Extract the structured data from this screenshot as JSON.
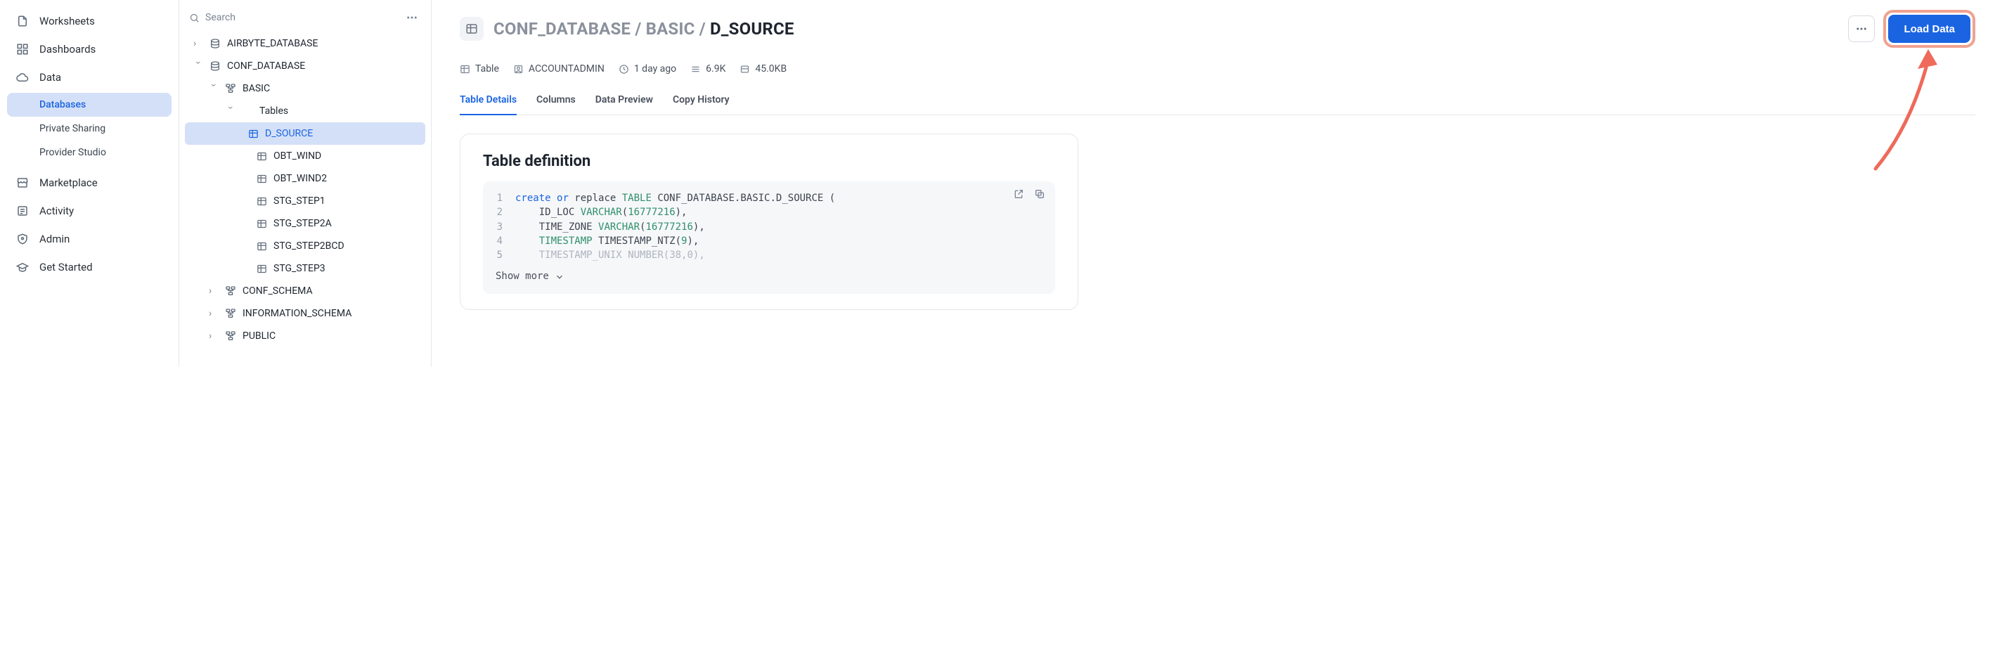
{
  "nav": {
    "items": [
      {
        "label": "Worksheets"
      },
      {
        "label": "Dashboards"
      },
      {
        "label": "Data"
      },
      {
        "label": "Marketplace"
      },
      {
        "label": "Activity"
      },
      {
        "label": "Admin"
      },
      {
        "label": "Get Started"
      }
    ],
    "data_sub": [
      {
        "label": "Databases"
      },
      {
        "label": "Private Sharing"
      },
      {
        "label": "Provider Studio"
      }
    ]
  },
  "search": {
    "placeholder": "Search"
  },
  "tree": {
    "db_airbyte": "AIRBYTE_DATABASE",
    "db_conf": "CONF_DATABASE",
    "schema_basic": "BASIC",
    "group_tables": "Tables",
    "tables": [
      "D_SOURCE",
      "OBT_WIND",
      "OBT_WIND2",
      "STG_STEP1",
      "STG_STEP2A",
      "STG_STEP2BCD",
      "STG_STEP3"
    ],
    "schema_conf": "CONF_SCHEMA",
    "schema_info": "INFORMATION_SCHEMA",
    "schema_public": "PUBLIC"
  },
  "header": {
    "crumb_db": "CONF_DATABASE",
    "crumb_schema": "BASIC",
    "crumb_table": "D_SOURCE",
    "load_label": "Load Data"
  },
  "meta": {
    "type": "Table",
    "role": "ACCOUNTADMIN",
    "age": "1 day ago",
    "rows": "6.9K",
    "size": "45.0KB"
  },
  "tabs": [
    "Table Details",
    "Columns",
    "Data Preview",
    "Copy History"
  ],
  "card": {
    "title": "Table definition",
    "show_more": "Show more"
  },
  "code": {
    "full_ident": "CONF_DATABASE.BASIC.D_SOURCE",
    "col1": "ID_LOC",
    "col1_type": "VARCHAR",
    "col1_arg": "16777216",
    "col2": "TIME_ZONE",
    "col2_type": "VARCHAR",
    "col2_arg": "16777216",
    "col3": "TIMESTAMP",
    "col3_type": "TIMESTAMP_NTZ",
    "col3_arg": "9",
    "col4": "TIMESTAMP_UNIX",
    "col4_type": "NUMBER",
    "col4_arg": "38,0"
  }
}
